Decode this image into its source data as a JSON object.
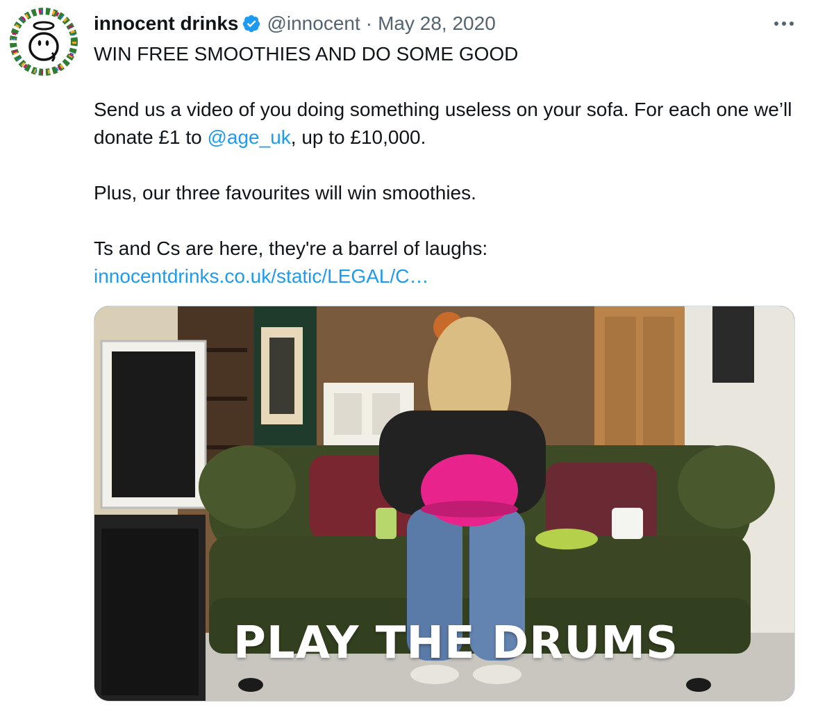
{
  "tweet": {
    "author": {
      "display_name": "innocent drinks",
      "handle": "@innocent",
      "avatar_icon": "innocent-logo-icon",
      "verified_icon": "verified-badge-icon"
    },
    "separator": "·",
    "date": "May 28, 2020",
    "more_icon": "more-dots-icon",
    "text": {
      "headline": "WIN FREE SMOOTHIES AND DO SOME GOOD",
      "p2_before": "Send us a video of you doing something useless on your sofa. For each one we’ll donate £1 to ",
      "p2_mention": "@age_uk",
      "p2_after": ", up to £10,000.",
      "p3": "Plus, our three favourites will win smoothies.",
      "p4": "Ts and Cs are here, they're a barrel of laughs:",
      "p4_link": "innocentdrinks.co.uk/static/LEGAL/C…"
    },
    "media": {
      "caption": "PLAY THE DRUMS"
    },
    "colors": {
      "link": "#1d9bf0",
      "secondary_text": "#536471",
      "verified": "#1d9bf0"
    }
  }
}
